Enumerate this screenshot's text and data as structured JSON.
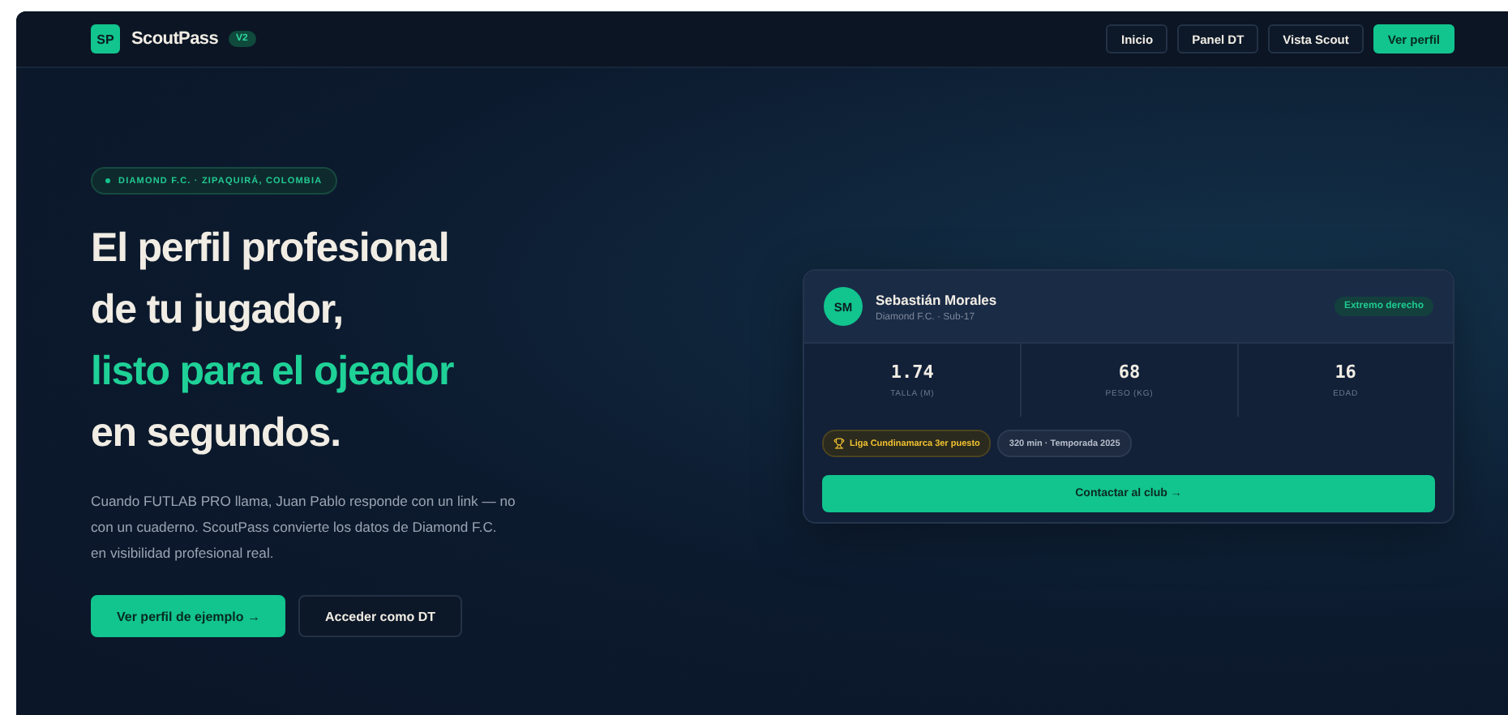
{
  "header": {
    "logo_mark": "SP",
    "brand": "ScoutPass",
    "version": "V2",
    "nav": [
      {
        "label": "Inicio",
        "selected": false
      },
      {
        "label": "Panel DT",
        "selected": false
      },
      {
        "label": "Vista Scout",
        "selected": false
      },
      {
        "label": "Ver perfil",
        "selected": true
      }
    ]
  },
  "hero": {
    "location_tag": "DIAMOND F.C. · ZIPAQUIRÁ, COLOMBIA",
    "title_lines": [
      {
        "text": "El perfil profesional",
        "accent": false
      },
      {
        "text": "de tu jugador,",
        "accent": false
      },
      {
        "text": "listo para el ojeador",
        "accent": true
      },
      {
        "text": "en segundos.",
        "accent": false
      }
    ],
    "description": "Cuando FUTLAB PRO llama, Juan Pablo responde con un link — no con un cuaderno. ScoutPass convierte los datos de Diamond F.C. en visibilidad profesional real.",
    "buttons": [
      {
        "label": "Ver perfil de ejemplo →",
        "kind": "primary"
      },
      {
        "label": "Acceder como DT",
        "kind": "secondary"
      }
    ]
  },
  "player_card": {
    "initials": "SM",
    "name": "Sebastián Morales",
    "club": "Diamond F.C. · Sub-17",
    "position": "Extremo derecho",
    "stats": [
      {
        "value": "1.74",
        "label": "TALLA (M)"
      },
      {
        "value": "68",
        "label": "PESO (KG)"
      },
      {
        "value": "16",
        "label": "EDAD"
      }
    ],
    "tags": [
      {
        "text": "Liga Cundinamarca 3er puesto",
        "kind": "award"
      },
      {
        "text": "320 min · Temporada 2025",
        "kind": "info"
      }
    ],
    "contact_button": "Contactar al club →"
  }
}
